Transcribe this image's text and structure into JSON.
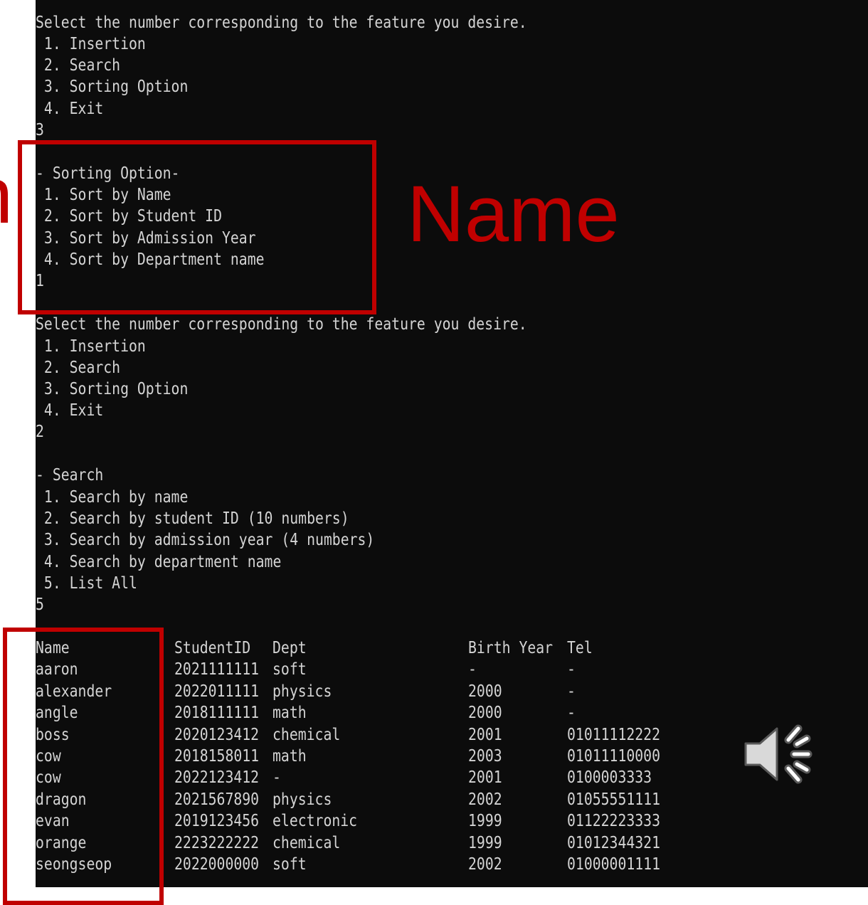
{
  "console": {
    "menu1": {
      "prompt": "Select the number corresponding to the feature you desire.",
      "items": [
        " 1. Insertion",
        " 2. Search",
        " 3. Sorting Option",
        " 4. Exit"
      ],
      "input": "3"
    },
    "sorting": {
      "title": "- Sorting Option-",
      "items": [
        " 1. Sort by Name",
        " 2. Sort by Student ID",
        " 3. Sort by Admission Year",
        " 4. Sort by Department name"
      ],
      "input": "1"
    },
    "menu2": {
      "prompt": "Select the number corresponding to the feature you desire.",
      "items": [
        " 1. Insertion",
        " 2. Search",
        " 3. Sorting Option",
        " 4. Exit"
      ],
      "input": "2"
    },
    "search": {
      "title": "- Search",
      "items": [
        " 1. Search by name",
        " 2. Search by student ID (10 numbers)",
        " 3. Search by admission year (4 numbers)",
        " 4. Search by department name",
        " 5. List All"
      ],
      "input": "5"
    },
    "table": {
      "headers": [
        "Name",
        "StudentID",
        "Dept",
        "Birth Year",
        "Tel"
      ],
      "rows": [
        [
          "aaron",
          "2021111111",
          "soft",
          "-",
          "-"
        ],
        [
          "alexander",
          "2022011111",
          "physics",
          "2000",
          "-"
        ],
        [
          "angle",
          "2018111111",
          "math",
          "2000",
          "-"
        ],
        [
          "boss",
          "2020123412",
          "chemical",
          "2001",
          "01011112222"
        ],
        [
          "cow",
          "2018158011",
          "math",
          "2003",
          "01011110000"
        ],
        [
          "cow",
          "2022123412",
          "-",
          "2001",
          "0100003333"
        ],
        [
          "dragon",
          "2021567890",
          "physics",
          "2002",
          "01055551111"
        ],
        [
          "evan",
          "2019123456",
          "electronic",
          "1999",
          "01122223333"
        ],
        [
          "orange",
          "2223222222",
          "chemical",
          "1999",
          "01012344321"
        ],
        [
          "seongseop",
          "2022000000",
          "soft",
          "2002",
          "01000001111"
        ]
      ]
    }
  },
  "annotation": {
    "label": "Name",
    "edge_glyph": "n",
    "color": "#c00000"
  },
  "speaker_icon": "speaker-volume-icon"
}
